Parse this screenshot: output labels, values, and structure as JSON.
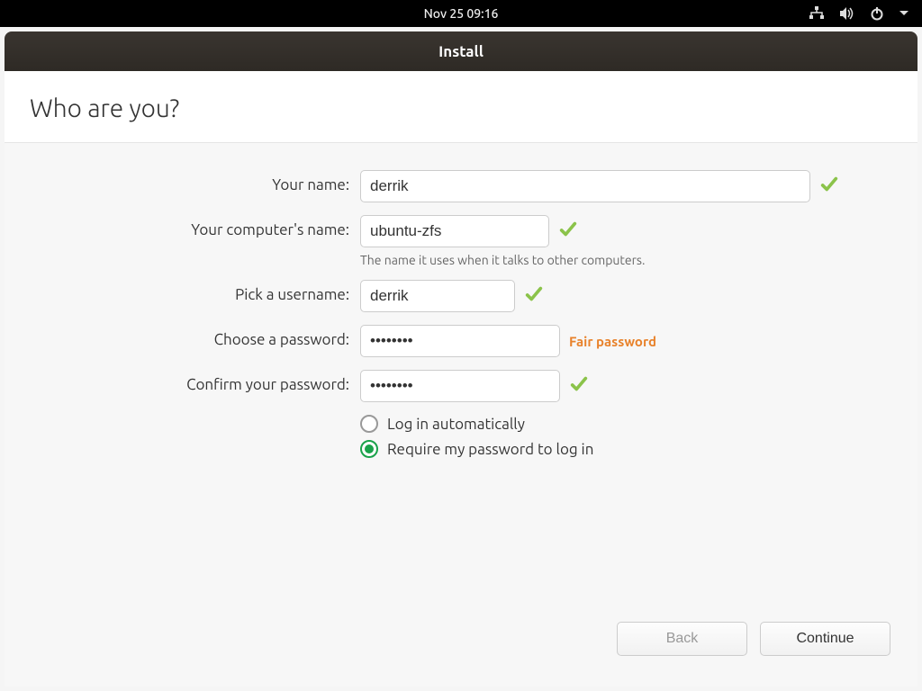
{
  "topbar": {
    "datetime": "Nov 25  09:16"
  },
  "window": {
    "title": "Install"
  },
  "page": {
    "heading": "Who are you?"
  },
  "form": {
    "name_label": "Your name:",
    "name_value": "derrik",
    "computer_label": "Your computer's name:",
    "computer_value": "ubuntu-zfs",
    "computer_hint": "The name it uses when it talks to other computers.",
    "username_label": "Pick a username:",
    "username_value": "derrik",
    "password_label": "Choose a password:",
    "password_value": "••••••••",
    "password_strength": "Fair password",
    "confirm_label": "Confirm your password:",
    "confirm_value": "••••••••",
    "login_auto_label": "Log in automatically",
    "login_password_label": "Require my password to log in"
  },
  "footer": {
    "back_label": "Back",
    "continue_label": "Continue"
  }
}
